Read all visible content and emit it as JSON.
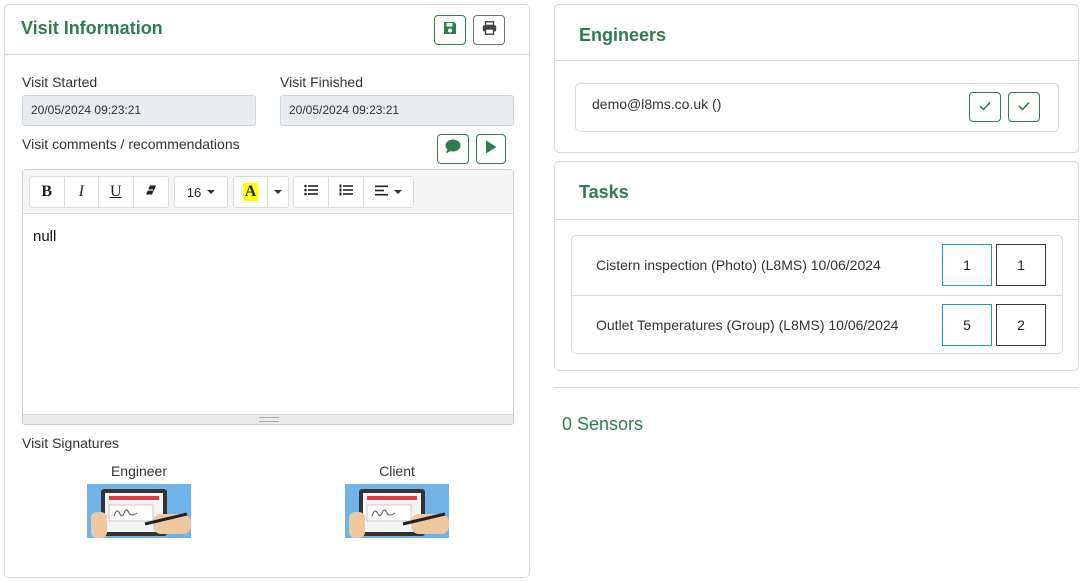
{
  "visit": {
    "title": "Visit Information",
    "save_icon": "save-icon",
    "print_icon": "print-icon",
    "started_label": "Visit Started",
    "started_value": "20/05/2024 09:23:21",
    "finished_label": "Visit Finished",
    "finished_value": "20/05/2024 09:23:21",
    "comments_label": "Visit comments / recommendations",
    "comment_icon": "comment-icon",
    "play_icon": "play-icon",
    "editor": {
      "toolbar": {
        "bold": "B",
        "italic": "I",
        "underline": "U",
        "eraser_icon": "eraser-icon",
        "font_size": "16",
        "highlight": "A",
        "highlight_color": "#ffff00",
        "ul_icon": "unordered-list-icon",
        "ol_icon": "ordered-list-icon",
        "align_icon": "align-icon"
      },
      "content": "null"
    },
    "signatures_label": "Visit Signatures",
    "signatures": [
      {
        "label": "Engineer",
        "icon": "signature-tablet-icon"
      },
      {
        "label": "Client",
        "icon": "signature-tablet-icon"
      }
    ]
  },
  "engineers": {
    "title": "Engineers",
    "items": [
      {
        "email": "demo@l8ms.co.uk ()",
        "icons": [
          "check-icon",
          "check-icon"
        ]
      }
    ]
  },
  "tasks": {
    "title": "Tasks",
    "items": [
      {
        "name": "Cistern inspection (Photo) (L8MS) 10/06/2024",
        "count_a": "1",
        "count_b": "1"
      },
      {
        "name": "Outlet Temperatures (Group) (L8MS) 10/06/2024",
        "count_a": "5",
        "count_b": "2"
      }
    ]
  },
  "sensors": {
    "label": "0 Sensors"
  },
  "colors": {
    "accent": "#2e7d4f",
    "teal": "#17a2b8",
    "dark": "#343a40",
    "field_bg": "#e9ecef"
  }
}
